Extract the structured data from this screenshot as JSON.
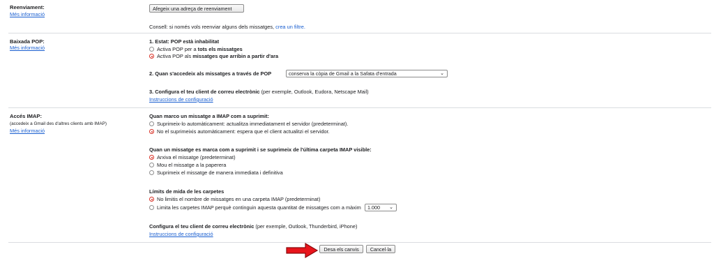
{
  "forwarding": {
    "label": "Reenviament:",
    "more_info": "Més informació",
    "add_button": "Afegeix una adreça de reenviament",
    "tip_prefix": "Consell: si només vols reenviar alguns dels missatges, ",
    "tip_link": "crea un filtre."
  },
  "pop": {
    "label": "Baixada POP:",
    "more_info": "Més informació",
    "status_header": "1. Estat: POP està inhabilitat",
    "option1_prefix": "Activa POP per a ",
    "option1_bold": "tots els missatges",
    "option2_prefix": "Activa POP als ",
    "option2_bold": "missatges que arribin a partir d'ara",
    "access_header": "2. Quan s'accedeix als missatges a través de POP",
    "access_select": "conserva la còpia de Gmail a la Safata d'entrada",
    "config_header": "3. Configura el teu client de correu electrònic",
    "config_examples": " (per exemple, Outlook, Eudora, Netscape Mail)",
    "config_link": "Instruccions de configuració"
  },
  "imap": {
    "label": "Accés IMAP:",
    "sublabel": "(accedeix a Gmail des d'altres clients amb IMAP)",
    "more_info": "Més informació",
    "deleted_header": "Quan marco un missatge a IMAP com a suprimit:",
    "deleted_opt1": "Suprimeix-lo automàticament: actualitza immediatament el servidor (predeterminat).",
    "deleted_opt2": "No el suprimeixis automàticament: espera que el client actualitzi el servidor.",
    "expunge_header": "Quan un missatge es marca com a suprimit i se suprimeix de l'última carpeta IMAP visible:",
    "expunge_opt1": "Arxiva el missatge (predeterminat)",
    "expunge_opt2": "Mou el missatge a la paperera",
    "expunge_opt3": "Suprimeix el missatge de manera immediata i definitiva",
    "folder_header": "Límits de mida de les carpetes",
    "folder_opt1": "No limitis el nombre de missatges en una carpeta IMAP (predeterminat)",
    "folder_opt2": "Limita les carpetes IMAP perquè continguin aquesta quantitat de missatges com a màxim",
    "folder_limit_select": "1.000",
    "config_header": "Configura el teu client de correu electrònic",
    "config_examples": " (per exemple, Outlook, Thunderbird, iPhone)",
    "config_link": "Instruccions de configuració"
  },
  "footer": {
    "save_button": "Desa els canvis",
    "cancel_button": "Cancel·la"
  },
  "colors": {
    "link": "#1a5fd0",
    "radio_selected": "#d93025",
    "arrow": "#e8141b"
  },
  "icons": [
    "chevron-down-icon",
    "red-arrow-icon"
  ]
}
